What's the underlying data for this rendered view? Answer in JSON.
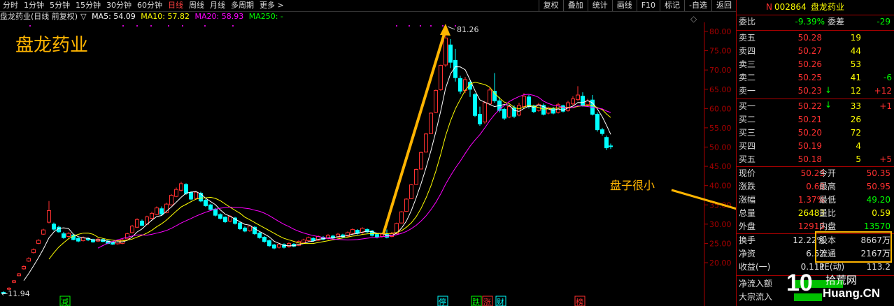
{
  "toolbar": {
    "periods": [
      "分时",
      "1分钟",
      "5分钟",
      "15分钟",
      "30分钟",
      "60分钟",
      "日线",
      "周线",
      "月线",
      "多周期",
      "更多 >"
    ],
    "active_period": "日线",
    "actions": [
      "复权",
      "叠加",
      "统计",
      "画线",
      "F10",
      "标记",
      "-自选",
      "返回"
    ]
  },
  "ma_line": {
    "prefix": "盘龙药业(日线 前复权)",
    "ma5": "MA5: 54.09",
    "ma10": "MA10: 57.82",
    "ma20": "MA20: 58.93",
    "ma250": "MA250: -"
  },
  "chart_overlay_title": "盘龙药业",
  "price_axis": {
    "labels": [
      "80.00",
      "75.00",
      "70.00",
      "65.00",
      "60.00",
      "55.00",
      "50.00",
      "45.00",
      "40.00",
      "35.00",
      "30.00",
      "25.00",
      "20.00"
    ]
  },
  "high_label": "81.26",
  "low_label": "11.94",
  "bottom_markers": [
    "减",
    "停",
    "跌",
    "涨",
    "财",
    "榜"
  ],
  "annotation": "盘子很小",
  "quote_panel": {
    "n_badge": "N",
    "code": "002864",
    "name": "盘龙药业",
    "weibi_label": "委比",
    "weibi_value": "-9.39%",
    "weicha_label": "委差",
    "weicha_value": "-29",
    "asks": [
      {
        "label": "卖五",
        "price": "50.28",
        "vol": "19",
        "chg": ""
      },
      {
        "label": "卖四",
        "price": "50.27",
        "vol": "44",
        "chg": ""
      },
      {
        "label": "卖三",
        "price": "50.26",
        "vol": "53",
        "chg": ""
      },
      {
        "label": "卖二",
        "price": "50.25",
        "vol": "41",
        "chg": "-6"
      },
      {
        "label": "卖一",
        "price": "50.23",
        "vol": "12",
        "chg": "+12"
      }
    ],
    "bids": [
      {
        "label": "买一",
        "price": "50.22",
        "vol": "33",
        "chg": "+1"
      },
      {
        "label": "买二",
        "price": "50.21",
        "vol": "26",
        "chg": ""
      },
      {
        "label": "买三",
        "price": "50.20",
        "vol": "72",
        "chg": ""
      },
      {
        "label": "买四",
        "price": "50.19",
        "vol": "4",
        "chg": ""
      },
      {
        "label": "买五",
        "price": "50.18",
        "vol": "5",
        "chg": "+5"
      }
    ],
    "stats": [
      {
        "l1": "现价",
        "v1": "50.23",
        "l2": "今开",
        "v2": "50.35"
      },
      {
        "l1": "涨跌",
        "v1": "0.68",
        "l2": "最高",
        "v2": "50.95"
      },
      {
        "l1": "涨幅",
        "v1": "1.37%",
        "l2": "最低",
        "v2": "49.20"
      },
      {
        "l1": "总量",
        "v1": "26483",
        "l2": "量比",
        "v2": "0.59"
      },
      {
        "l1": "外盘",
        "v1": "12913",
        "l2": "内盘",
        "v2": "13570"
      }
    ],
    "stats2": [
      {
        "l1": "换手",
        "v1": "12.22%",
        "l2": "股本",
        "v2": "8667万"
      },
      {
        "l1": "净资",
        "v1": "6.52",
        "l2": "流通",
        "v2": "2167万"
      },
      {
        "l1": "收益(一)",
        "v1": "0.111",
        "l2": "PE(动)",
        "v2": "113.2"
      }
    ],
    "flows": [
      {
        "label": "净流入额"
      },
      {
        "label": "大宗流入"
      }
    ]
  },
  "watermark": {
    "top": "10",
    "site": "拾荒网",
    "domain": "Huang.CN"
  },
  "colors": {
    "up": "#ff3030",
    "down": "#00ffff",
    "ma5": "#ffffff",
    "ma10": "#ffff00",
    "ma20": "#ff00ff",
    "accent": "#ffb400"
  }
}
